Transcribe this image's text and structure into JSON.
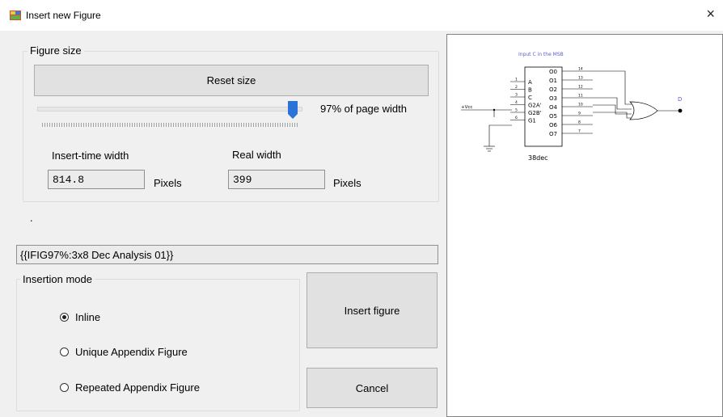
{
  "window": {
    "title": "Insert new Figure",
    "close_symbol": "×",
    "icon": "window-app-icon"
  },
  "figure_size": {
    "legend": "Figure size",
    "reset_button": "Reset size",
    "slider_percent": 97,
    "slider_label": "97% of page width",
    "insert_time_label": "Insert-time width",
    "insert_time_value": "814.8",
    "insert_time_unit": "Pixels",
    "real_width_label": "Real width",
    "real_width_value": "399",
    "real_width_unit": "Pixels"
  },
  "dot_label": ".",
  "figure_code": "{{IFIG97%:3x8 Dec Analysis 01}}",
  "insertion_mode": {
    "legend": "Insertion mode",
    "options": [
      {
        "label": "Inline",
        "checked": true
      },
      {
        "label": "Unique Appendix Figure",
        "checked": false
      },
      {
        "label": "Repeated Appendix Figure",
        "checked": false
      }
    ]
  },
  "buttons": {
    "insert": "Insert figure",
    "cancel": "Cancel"
  },
  "preview": {
    "caption": "Input C in the MSB",
    "chip_label": "38dec",
    "inputs": [
      "A",
      "B",
      "C",
      "G2A'",
      "G2B'",
      "G1"
    ],
    "input_pins": [
      "1",
      "2",
      "3",
      "4",
      "5",
      "6"
    ],
    "outputs": [
      "O0",
      "O1",
      "O2",
      "O3",
      "O4",
      "O5",
      "O6",
      "O7"
    ],
    "output_pins": [
      "14",
      "13",
      "12",
      "11",
      "10",
      "9",
      "8",
      "7"
    ],
    "vcc_label": "+Vcc",
    "out_label": "D",
    "accent_color": "#5b5bd6"
  },
  "colors": {
    "slider_thumb": "#2a73d9",
    "window_bg": "#f0f0f0"
  }
}
